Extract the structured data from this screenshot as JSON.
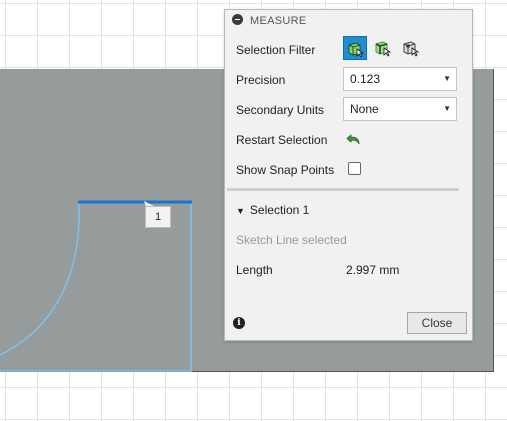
{
  "panel": {
    "title": "MEASURE",
    "selection_filter_label": "Selection Filter",
    "precision": {
      "label": "Precision",
      "value": "0.123"
    },
    "secondary_units": {
      "label": "Secondary Units",
      "value": "None"
    },
    "restart_selection_label": "Restart Selection",
    "show_snap_points_label": "Show Snap Points",
    "show_snap_points_checked": false,
    "selection_group": {
      "title": "Selection 1",
      "status": "Sketch Line selected",
      "length_label": "Length",
      "length_value": "2.997 mm"
    },
    "close_label": "Close"
  },
  "canvas": {
    "selection_marker": "1"
  },
  "colors": {
    "accent": "#1e8ed6",
    "plane": "#959c9b",
    "sketch_line": "#7ec3ef",
    "selected_line": "#1a73d1",
    "icon_green": "#3f9a3a"
  },
  "icons": [
    "minus-circle-icon",
    "face-filter-icon",
    "edge-filter-icon",
    "vertex-filter-icon",
    "restart-arrow-icon",
    "info-icon",
    "chevron-down-icon"
  ]
}
